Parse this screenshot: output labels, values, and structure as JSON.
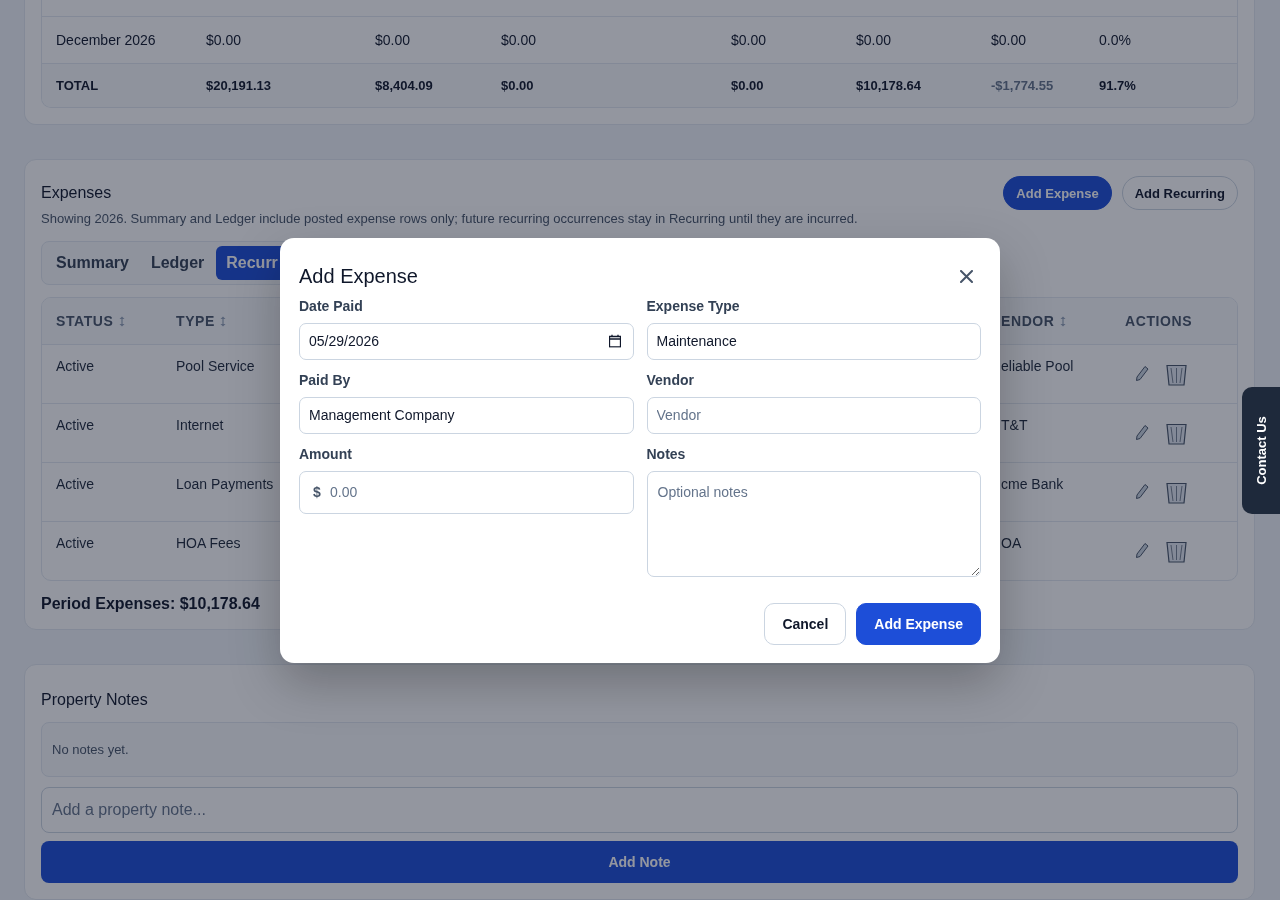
{
  "summary_table": {
    "rows": [
      {
        "kind": "month",
        "cells": [
          {
            "text": "December 2026",
            "negative": false
          },
          {
            "text": "$0.00",
            "negative": false
          },
          {
            "text": "$0.00",
            "negative": false
          },
          {
            "text": "$0.00",
            "negative": false
          },
          {
            "text": "$0.00",
            "negative": false
          },
          {
            "text": "$0.00",
            "negative": false
          },
          {
            "text": "$0.00",
            "negative": false
          },
          {
            "text": "0.0%",
            "negative": false
          }
        ]
      },
      {
        "kind": "total",
        "cells": [
          {
            "text": "TOTAL",
            "negative": false
          },
          {
            "text": "$20,191.13",
            "negative": false
          },
          {
            "text": "$8,404.09",
            "negative": false
          },
          {
            "text": "$0.00",
            "negative": false
          },
          {
            "text": "$0.00",
            "negative": false
          },
          {
            "text": "$10,178.64",
            "negative": false
          },
          {
            "text": "-$1,774.55",
            "negative": true
          },
          {
            "text": "91.7%",
            "negative": false
          }
        ]
      }
    ]
  },
  "expenses": {
    "title": "Expenses",
    "buttons": [
      {
        "label": "Add Expense",
        "kind": "primary"
      },
      {
        "label": "Add Recurring",
        "kind": "secondary"
      }
    ],
    "note": "Showing 2026. Summary and Ledger include posted expense rows only; future recurring occurrences stay in Recurring until they are incurred.",
    "tabs": [
      {
        "label": "Summary",
        "selected": false
      },
      {
        "label": "Ledger",
        "selected": false
      },
      {
        "label": "Recurr",
        "selected": true
      }
    ],
    "table": {
      "columns": [
        {
          "label": "STATUS",
          "sortable": true
        },
        {
          "label": "TYPE",
          "sortable": true
        },
        {
          "label": "ENDOR",
          "sortable": true
        },
        {
          "label": "ACTIONS",
          "sortable": false
        }
      ],
      "rows": [
        {
          "status": "Active",
          "type": "Pool Service",
          "vendor": "eliable Pool"
        },
        {
          "status": "Active",
          "type": "Internet",
          "vendor": "T&T"
        },
        {
          "status": "Active",
          "type": "Loan Payments",
          "vendor": "cme Bank"
        },
        {
          "status": "Active",
          "type": "HOA Fees",
          "vendor": "OA"
        }
      ]
    },
    "period_total": "Period Expenses: $10,178.64"
  },
  "property_notes": {
    "title": "Property Notes",
    "empty_text": "No notes yet.",
    "placeholder": "Add a property note...",
    "button": "Add Note"
  },
  "contact_tab": "Contact Us",
  "modal": {
    "title": "Add Expense",
    "fields": [
      {
        "label": "Date Paid",
        "kind": "date",
        "value": "05/29/2026"
      },
      {
        "label": "Expense Type",
        "kind": "text",
        "value": "Maintenance"
      },
      {
        "label": "Paid By",
        "kind": "text",
        "value": "Management Company"
      },
      {
        "label": "Vendor",
        "kind": "text",
        "placeholder": "Vendor"
      },
      {
        "label": "Amount",
        "kind": "currency",
        "prefix": "$",
        "placeholder": "0.00"
      },
      {
        "label": "Notes",
        "kind": "textarea",
        "placeholder": "Optional notes"
      }
    ],
    "buttons": [
      {
        "label": "Cancel",
        "kind": "secondary"
      },
      {
        "label": "Add Expense",
        "kind": "primary"
      }
    ]
  }
}
